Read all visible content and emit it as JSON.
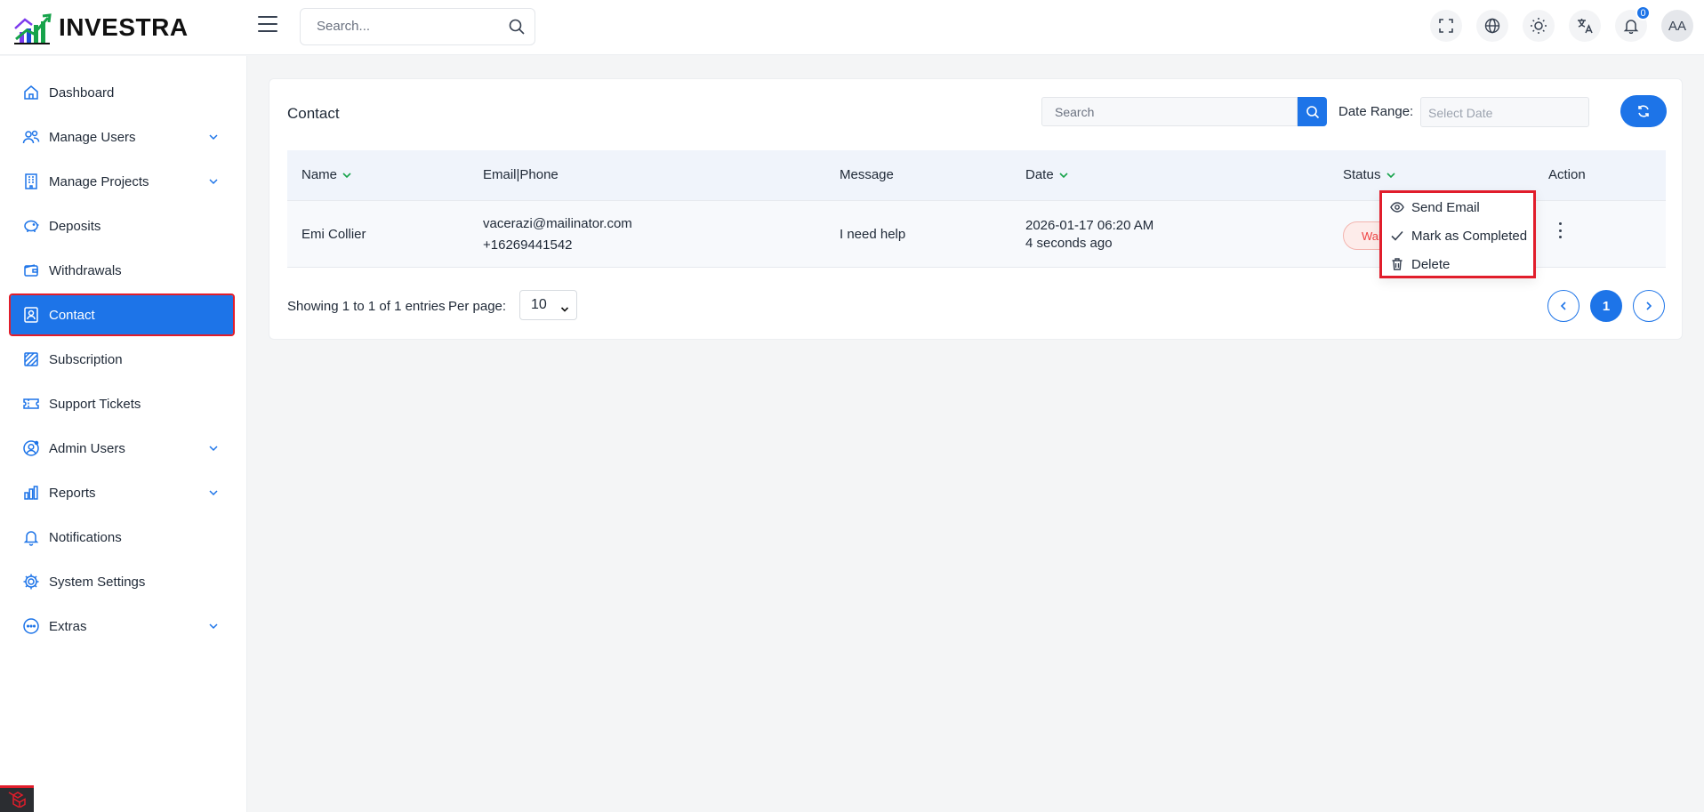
{
  "brand": {
    "name": "INVESTRA"
  },
  "topbar": {
    "search_placeholder": "Search...",
    "notification_count": "0",
    "avatar_initials": "AA"
  },
  "sidebar": {
    "items": [
      {
        "label": "Dashboard",
        "icon": "home-icon",
        "has_children": false,
        "active": false
      },
      {
        "label": "Manage Users",
        "icon": "users-icon",
        "has_children": true,
        "active": false
      },
      {
        "label": "Manage Projects",
        "icon": "building-icon",
        "has_children": true,
        "active": false
      },
      {
        "label": "Deposits",
        "icon": "piggy-bank-icon",
        "has_children": false,
        "active": false
      },
      {
        "label": "Withdrawals",
        "icon": "wallet-icon",
        "has_children": false,
        "active": false
      },
      {
        "label": "Contact",
        "icon": "contact-book-icon",
        "has_children": false,
        "active": true
      },
      {
        "label": "Subscription",
        "icon": "subscription-icon",
        "has_children": false,
        "active": false
      },
      {
        "label": "Support Tickets",
        "icon": "ticket-icon",
        "has_children": false,
        "active": false
      },
      {
        "label": "Admin Users",
        "icon": "admin-user-icon",
        "has_children": true,
        "active": false
      },
      {
        "label": "Reports",
        "icon": "bar-chart-icon",
        "has_children": true,
        "active": false
      },
      {
        "label": "Notifications",
        "icon": "bell-icon",
        "has_children": false,
        "active": false
      },
      {
        "label": "System Settings",
        "icon": "gear-icon",
        "has_children": false,
        "active": false
      },
      {
        "label": "Extras",
        "icon": "more-circle-icon",
        "has_children": true,
        "active": false
      }
    ]
  },
  "card": {
    "title": "Contact",
    "search_placeholder": "Search",
    "date_range_label": "Date Range:",
    "date_placeholder": "Select Date"
  },
  "table": {
    "columns": [
      {
        "label": "Name",
        "sortable": true
      },
      {
        "label": "Email|Phone",
        "sortable": false
      },
      {
        "label": "Message",
        "sortable": false
      },
      {
        "label": "Date",
        "sortable": true
      },
      {
        "label": "Status",
        "sortable": true
      },
      {
        "label": "Action",
        "sortable": false
      }
    ],
    "rows": [
      {
        "name": "Emi Collier",
        "email": "vacerazi@mailinator.com",
        "phone": "+16269441542",
        "message": "I need help",
        "date": "2026-01-17 06:20 AM",
        "date_relative": "4 seconds ago",
        "status": "Waiting"
      }
    ]
  },
  "action_menu": {
    "items": [
      {
        "label": "Send Email",
        "icon": "eye-icon"
      },
      {
        "label": "Mark as Completed",
        "icon": "check-icon"
      },
      {
        "label": "Delete",
        "icon": "trash-icon"
      }
    ]
  },
  "pagination": {
    "entries_text": "Showing 1 to 1 of 1 entries",
    "per_page_label": "Per page:",
    "per_page_value": "10",
    "current_page": "1"
  },
  "colors": {
    "primary": "#1d74e8",
    "highlight_border": "#e11d2b",
    "status_waiting": "#ef4444",
    "sort_arrow": "#16a34a"
  }
}
